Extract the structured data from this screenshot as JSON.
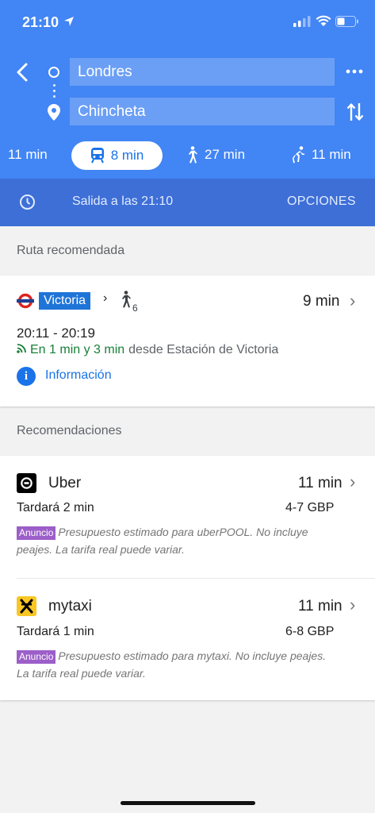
{
  "status_bar": {
    "time": "21:10"
  },
  "search": {
    "origin": "Londres",
    "destination": "Chincheta"
  },
  "modes": [
    {
      "name": "drive",
      "icon": "car-icon",
      "label": "11 min"
    },
    {
      "name": "transit",
      "icon": "train-icon",
      "label": "8 min",
      "selected": true
    },
    {
      "name": "walk",
      "icon": "walking-icon",
      "label": "27 min"
    },
    {
      "name": "cycle",
      "icon": "cycling-icon",
      "label": "11 min"
    }
  ],
  "options_bar": {
    "departure": "Salida a las 21:10",
    "options_label": "OPCIONES"
  },
  "recommended": {
    "section_label": "Ruta recomendada",
    "line_name": "Victoria",
    "walk_minutes": "6",
    "duration": "9 min",
    "times": "20:11 - 20:19",
    "live": "En 1 min y 3 min",
    "station": "desde Estación de Victoria",
    "info_label": "Información"
  },
  "recommendations": {
    "section_label": "Recomendaciones",
    "items": [
      {
        "name": "Uber",
        "duration": "11 min",
        "wait": "Tardará 2 min",
        "price": "4-7 GBP",
        "ad_label": "Anuncio",
        "ad_text": "Presupuesto estimado para uberPOOL. No incluye peajes. La tarifa real puede variar."
      },
      {
        "name": "mytaxi",
        "duration": "11 min",
        "wait": "Tardará 1 min",
        "price": "6-8 GBP",
        "ad_label": "Anuncio",
        "ad_text": "Presupuesto estimado para mytaxi. No incluye peajes. La tarifa real puede variar."
      }
    ]
  },
  "colors": {
    "header_blue": "#4285f4",
    "options_blue": "#3d6fd6",
    "link_blue": "#1a73e8",
    "live_green": "#188038",
    "ad_purple": "#9c5ec9",
    "mytaxi_yellow": "#f9c623"
  }
}
